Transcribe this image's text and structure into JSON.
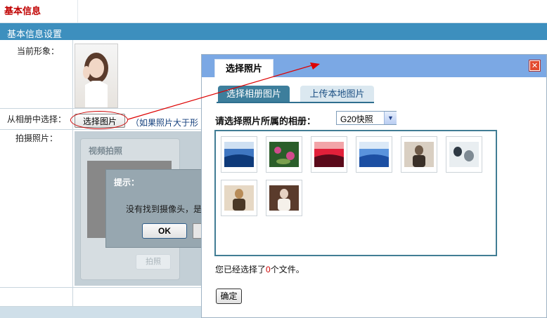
{
  "page": {
    "title": "基本信息",
    "section_title": "基本信息设置"
  },
  "form": {
    "current_avatar_label": "当前形象：",
    "album_select_label": "从相册中选择：",
    "select_photo_button": "选择图片",
    "note": "（如果照片大于形",
    "take_photo_label": "拍摄照片："
  },
  "camera": {
    "title": "视频拍照",
    "shoot_button": "拍照"
  },
  "alert": {
    "title": "提示：",
    "message": "没有找到摄像头，是",
    "ok_button": "OK"
  },
  "dialog": {
    "tab_title": "选择照片",
    "close_icon": "close-icon",
    "subtabs": [
      {
        "label": "选择相册图片",
        "active": true
      },
      {
        "label": "上传本地图片",
        "active": false
      }
    ],
    "album_label": "请选择照片所属的相册：",
    "album_value": "G20快照",
    "photos": [
      {
        "kind": "blue-wave",
        "colors": [
          "#0e3a7a",
          "#3f77c2",
          "#cfe0f2"
        ]
      },
      {
        "kind": "lotus",
        "colors": [
          "#2b5e2a",
          "#d14b8c",
          "#7aa04e"
        ]
      },
      {
        "kind": "sunset",
        "colors": [
          "#5a0a1a",
          "#e2203a",
          "#f2a4a8"
        ]
      },
      {
        "kind": "blue-sky",
        "colors": [
          "#1c4fa3",
          "#5a93dc",
          "#dbe9f7"
        ]
      },
      {
        "kind": "person-dark",
        "colors": [
          "#3a3028",
          "#6e5a48",
          "#d9cfc2"
        ]
      },
      {
        "kind": "group",
        "colors": [
          "#2f3a44",
          "#7e8a93",
          "#e9eef1"
        ]
      },
      {
        "kind": "person-mic",
        "colors": [
          "#4a3826",
          "#b88c58",
          "#e6d8c4"
        ]
      },
      {
        "kind": "girl",
        "colors": [
          "#f5f0ea",
          "#e6d2c3",
          "#5a3b2c"
        ]
      }
    ],
    "status_prefix": "您已经选择了",
    "status_count": "0",
    "status_suffix": "个文件。",
    "confirm_button": "确定"
  },
  "colors": {
    "header_blue": "#3d8fbe",
    "dialog_header": "#7ba8e4",
    "accent_red": "#c00000"
  }
}
